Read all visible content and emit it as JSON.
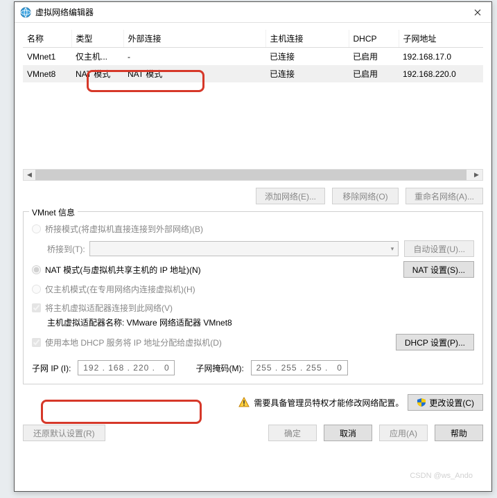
{
  "window": {
    "title": "虚拟网络编辑器"
  },
  "table": {
    "cols": [
      "名称",
      "类型",
      "外部连接",
      "主机连接",
      "DHCP",
      "子网地址"
    ],
    "rows": [
      {
        "name": "VMnet1",
        "type": "仅主机...",
        "ext": "-",
        "host": "已连接",
        "dhcp": "已启用",
        "subnet": "192.168.17.0"
      },
      {
        "name": "VMnet8",
        "type": "NAT 模式",
        "ext": "NAT 模式",
        "host": "已连接",
        "dhcp": "已启用",
        "subnet": "192.168.220.0"
      }
    ]
  },
  "buttons": {
    "add_net": "添加网络(E)...",
    "remove_net": "移除网络(O)",
    "rename_net": "重命名网络(A)...",
    "auto_setting": "自动设置(U)...",
    "nat_setting": "NAT 设置(S)...",
    "dhcp_setting": "DHCP 设置(P)...",
    "change_setting": "更改设置(C)",
    "restore": "还原默认设置(R)",
    "ok": "确定",
    "cancel": "取消",
    "apply": "应用(A)",
    "help": "帮助"
  },
  "group": {
    "legend": "VMnet 信息",
    "bridge_label": "桥接模式(将虚拟机直接连接到外部网络)(B)",
    "bridge_to": "桥接到(T):",
    "nat_label": "NAT 模式(与虚拟机共享主机的 IP 地址)(N)",
    "host_only_label": "仅主机模式(在专用网络内连接虚拟机)(H)",
    "connect_host_label": "将主机虚拟适配器连接到此网络(V)",
    "adapter_name": "主机虚拟适配器名称: VMware 网络适配器 VMnet8",
    "use_dhcp_label": "使用本地 DHCP 服务将 IP 地址分配给虚拟机(D)",
    "subnet_ip_label": "子网 IP (I):",
    "subnet_ip_value": "192 . 168 . 220 .   0",
    "subnet_mask_label": "子网掩码(M):",
    "subnet_mask_value": "255 . 255 . 255 .   0"
  },
  "admin": {
    "text": "需要具备管理员特权才能修改网络配置。"
  },
  "watermark": "CSDN @ws_Ando"
}
